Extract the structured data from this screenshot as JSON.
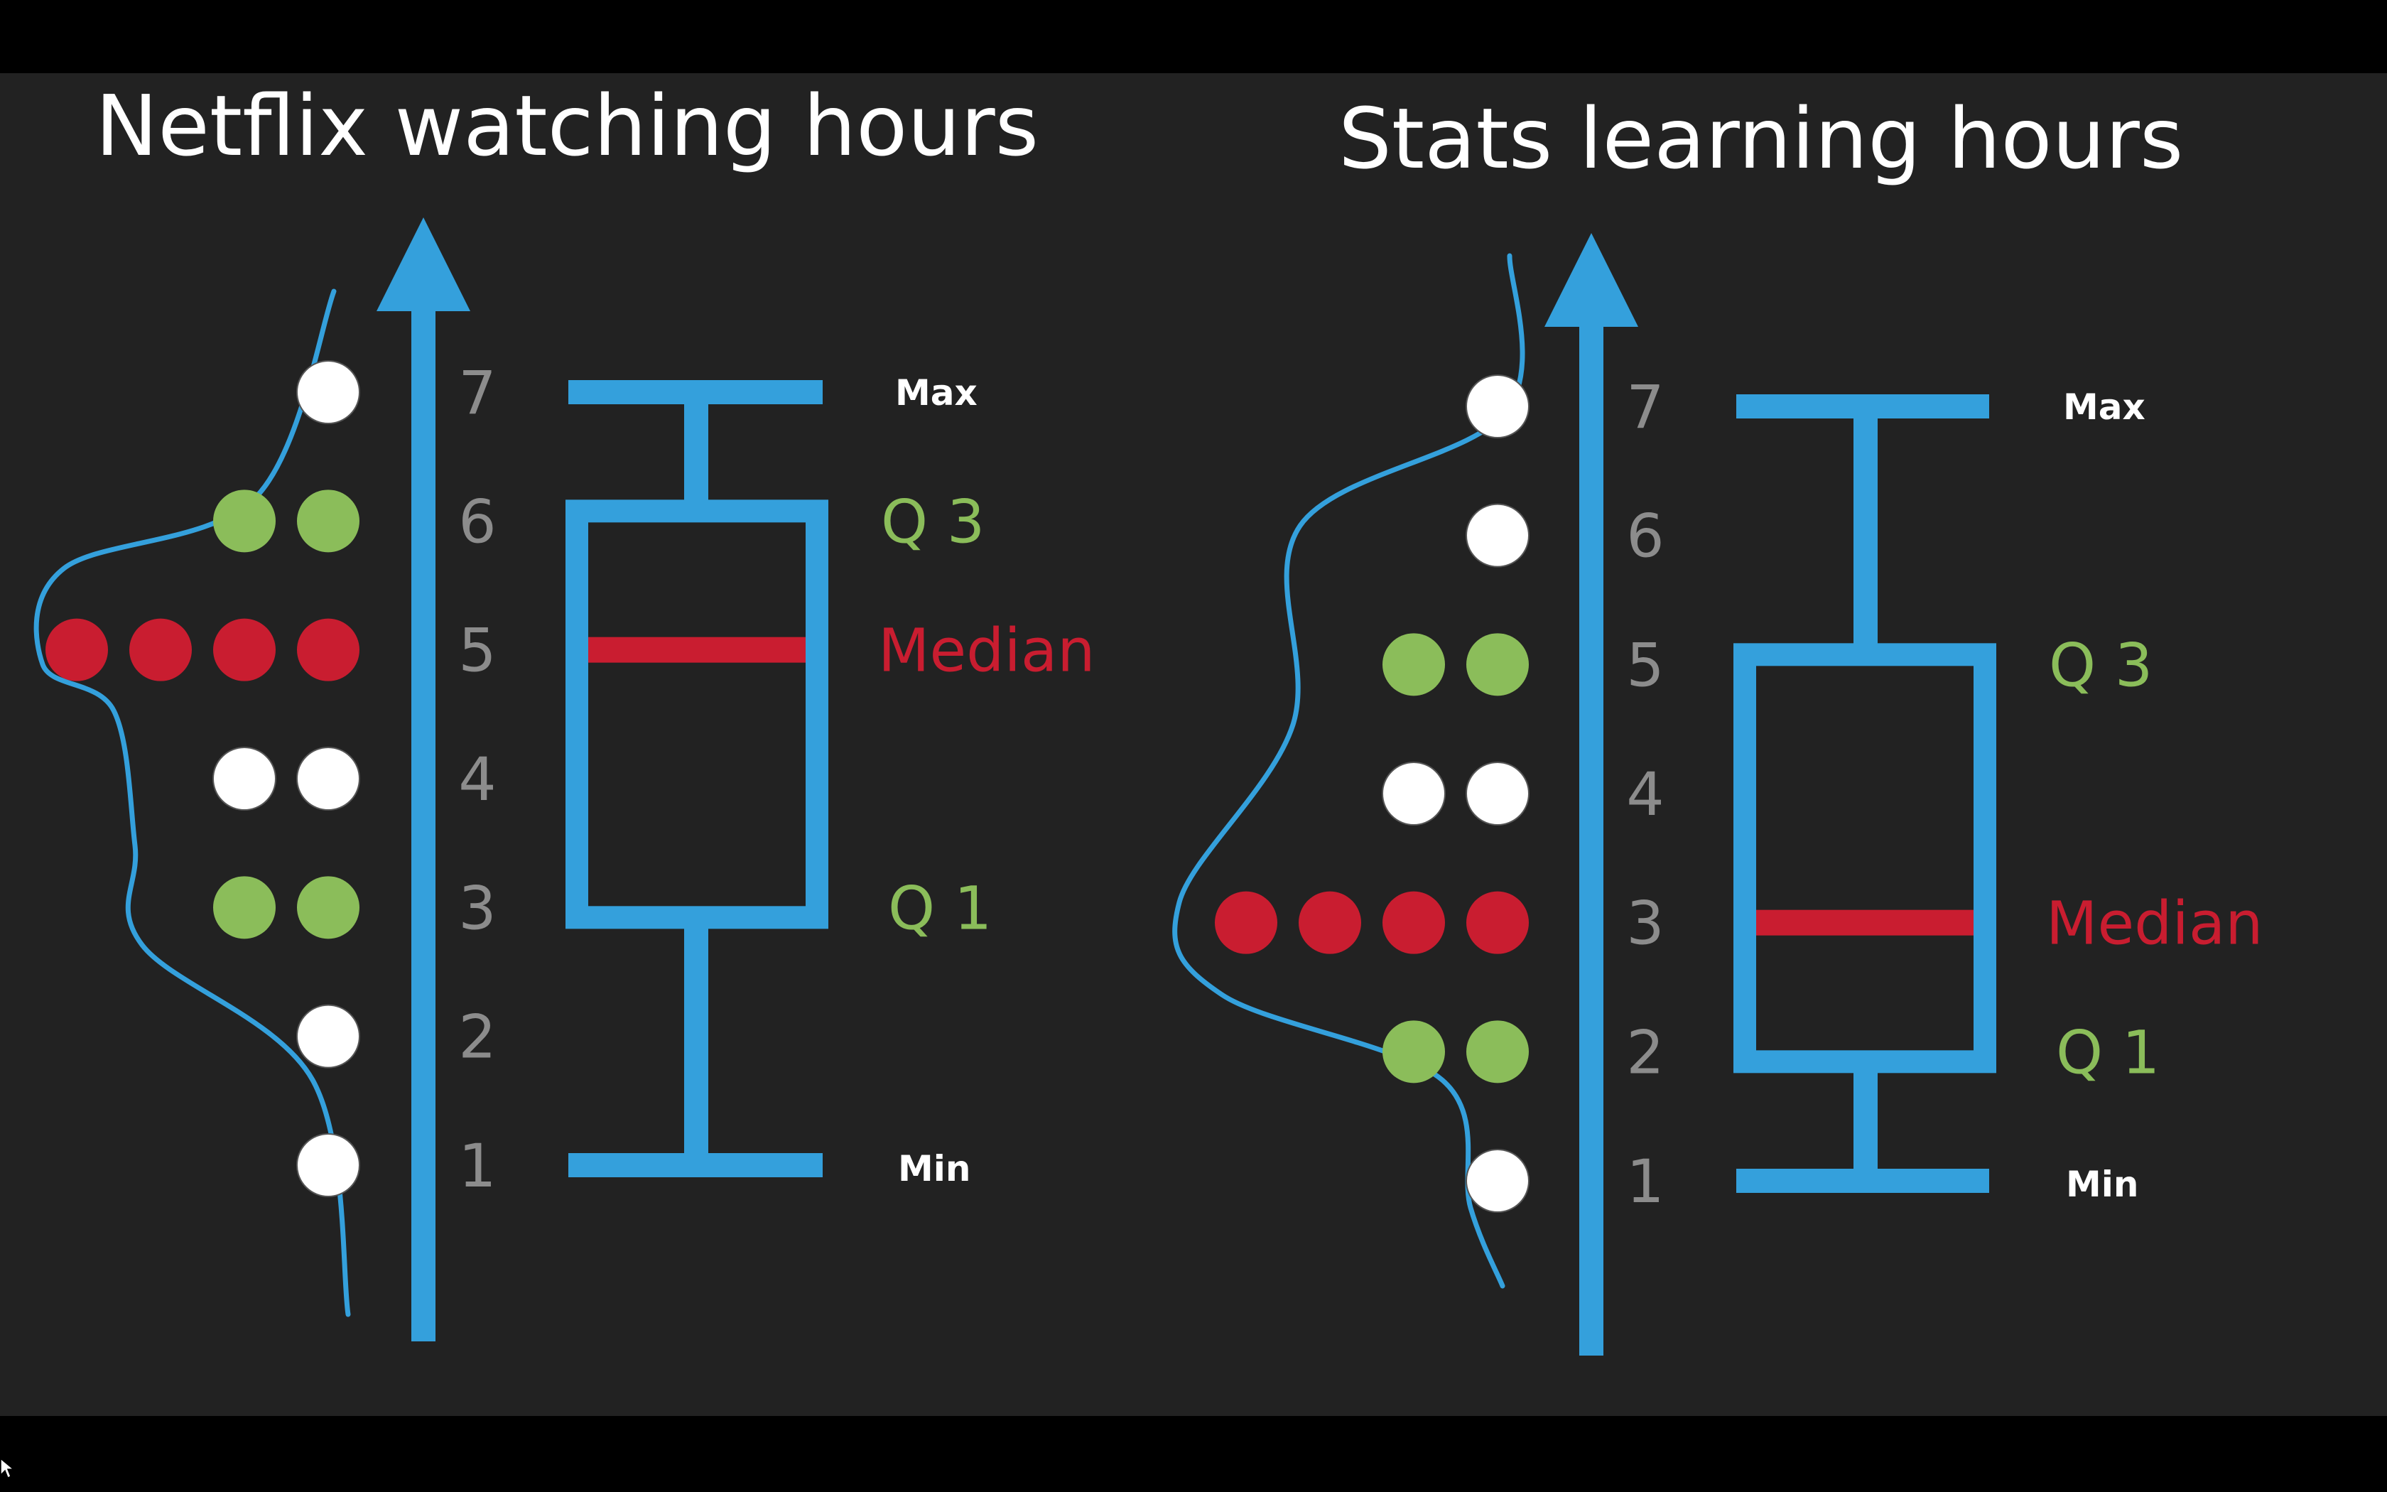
{
  "colors": {
    "page": "#000000",
    "panel": "#222222",
    "axis": "#34A0DC",
    "white": "#FFFFFF",
    "tick": "#8C8C8C",
    "quartile": "#8BBD5A",
    "median": "#C91D30"
  },
  "chart_data": [
    {
      "type": "box",
      "title": "Netflix watching hours",
      "y_ticks": [
        1,
        2,
        3,
        4,
        5,
        6,
        7
      ],
      "ylim": [
        1,
        7
      ],
      "observations": [
        1,
        2,
        3,
        3,
        4,
        4,
        5,
        5,
        5,
        5,
        6,
        6,
        7
      ],
      "point_colors": {
        "1": "white",
        "2": "white",
        "3": "quartile",
        "4": "white",
        "5": "median",
        "6": "quartile",
        "7": "white"
      },
      "summary": {
        "min": 1,
        "q1": 3,
        "median": 5,
        "q3": 6,
        "max": 7
      },
      "labels": {
        "max": "Max",
        "q3": "Q 3",
        "median": "Median",
        "q1": "Q 1",
        "min": "Min"
      },
      "density_curve": true
    },
    {
      "type": "box",
      "title": "Stats learning hours",
      "y_ticks": [
        1,
        2,
        3,
        4,
        5,
        6,
        7
      ],
      "ylim": [
        1,
        7
      ],
      "observations": [
        1,
        2,
        2,
        3,
        3,
        3,
        3,
        4,
        4,
        5,
        5,
        6,
        7
      ],
      "point_colors": {
        "1": "white",
        "2": "quartile",
        "3": "median",
        "4": "white",
        "5": "quartile",
        "6": "white",
        "7": "white"
      },
      "summary": {
        "min": 1,
        "q1": 2,
        "median": 3,
        "q3": 5,
        "max": 7
      },
      "labels": {
        "max": "Max",
        "q3": "Q 3",
        "median": "Median",
        "q1": "Q 1",
        "min": "Min"
      },
      "density_curve": true
    }
  ]
}
